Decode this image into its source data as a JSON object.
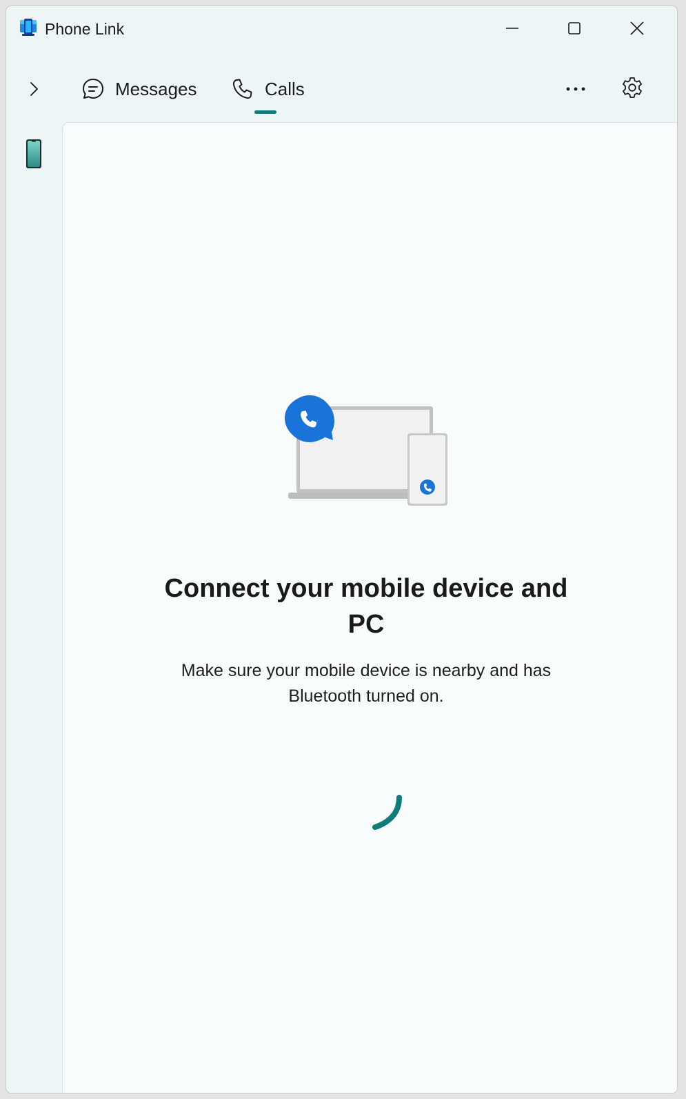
{
  "app": {
    "title": "Phone Link",
    "icon": "phone-link-app-icon"
  },
  "window_controls": {
    "minimize_icon": "minimize-icon",
    "maximize_icon": "maximize-icon",
    "close_icon": "close-icon"
  },
  "nav": {
    "expand_icon": "chevron-right-icon",
    "tabs": [
      {
        "label": "Messages",
        "icon": "chat-bubble-icon",
        "selected": false
      },
      {
        "label": "Calls",
        "icon": "phone-icon",
        "selected": true
      }
    ],
    "more_icon": "more-horizontal-icon",
    "settings_icon": "gear-icon"
  },
  "sidebar": {
    "device_icon": "mobile-device-icon"
  },
  "main": {
    "illustration": "laptop-phone-call-illustration",
    "heading": "Connect your mobile device and PC",
    "subtext": "Make sure your mobile device is nearby and has Bluetooth turned on.",
    "status": "loading"
  },
  "colors": {
    "accent": "#0f7b7a",
    "call_blue": "#1a73d8",
    "background": "#eef5f7",
    "panel": "#f8fcfd"
  }
}
